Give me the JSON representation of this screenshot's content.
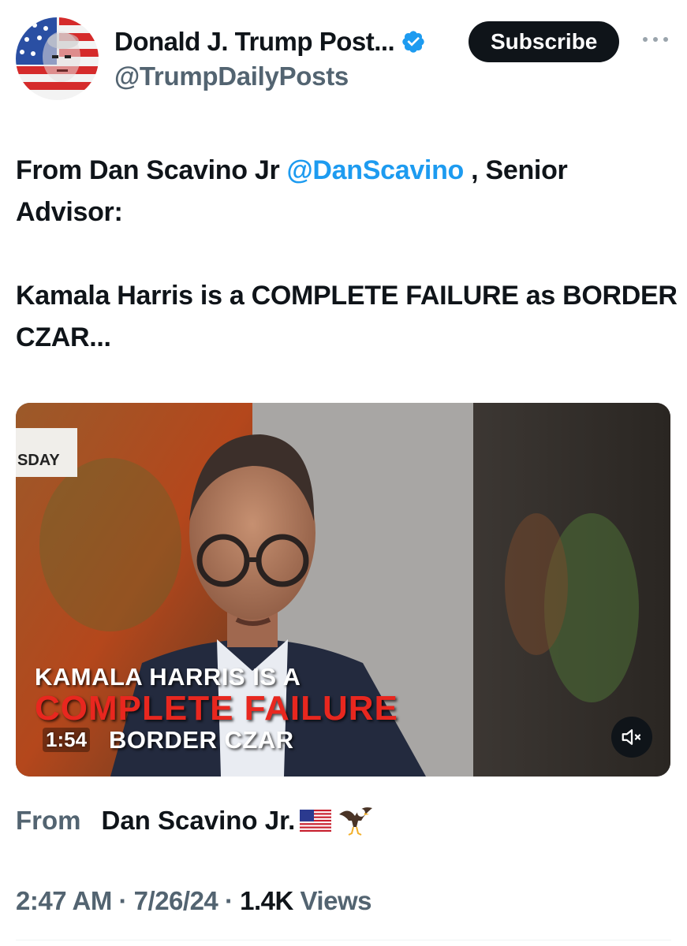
{
  "author": {
    "display_name": "Donald J. Trump Post...",
    "handle": "@TrumpDailyPosts",
    "verified": true,
    "avatar_icon": "flag-portrait-avatar"
  },
  "actions": {
    "subscribe_label": "Subscribe",
    "more_icon": "more-dots-icon"
  },
  "post": {
    "line1_prefix": "From Dan Scavino Jr ",
    "mention": "@DanScavino",
    "line1_suffix": " , Senior Advisor:",
    "line2": "Kamala Harris is a COMPLETE FAILURE as BORDER CZAR..."
  },
  "video": {
    "duration": "1:54",
    "caption_line1": "KAMALA HARRIS IS A",
    "caption_line2": "COMPLETE FAILURE",
    "caption_line3": "BORDER CZAR",
    "corner_tag": "SDAY",
    "mute_icon": "muted-speaker-icon"
  },
  "source": {
    "label": "From",
    "name": "Dan Scavino Jr.",
    "emoji_icons": [
      "us-flag-icon",
      "eagle-icon"
    ]
  },
  "meta": {
    "time": "2:47 AM",
    "date": "7/26/24",
    "views_count": "1.4K",
    "views_label": "Views",
    "separator": "·"
  },
  "colors": {
    "accent": "#1d9bf0",
    "text": "#0f1419",
    "secondary": "#536471",
    "caption_red": "#e8271f"
  }
}
